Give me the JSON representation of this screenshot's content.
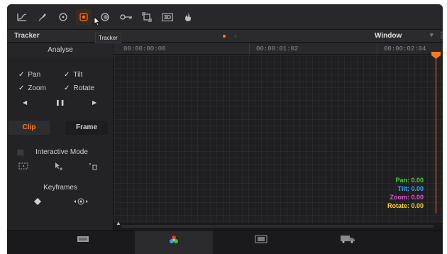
{
  "toolbar": {
    "icons": [
      "curves-icon",
      "qualifier-icon",
      "window-icon",
      "tracker-icon",
      "blur-icon",
      "key-icon",
      "sizing-icon",
      "3d-icon",
      "fire-icon"
    ],
    "three_d_label": "3D"
  },
  "tooltip": {
    "text": "Tracker"
  },
  "header": {
    "title": "Tracker",
    "mode": "Window",
    "mode_caret": "▾",
    "more": "⋮"
  },
  "left_panel": {
    "analyse_label": "Analyse",
    "checks": [
      {
        "label": "Pan",
        "checked": true
      },
      {
        "label": "Tilt",
        "checked": true
      },
      {
        "label": "Zoom",
        "checked": true
      },
      {
        "label": "Rotate",
        "checked": true
      }
    ],
    "check_mark": "✓",
    "playback": {
      "back": "◀",
      "pause": "❚❚",
      "forward": "▶"
    },
    "segments": {
      "clip": "Clip",
      "frame": "Frame",
      "selected": "Clip"
    },
    "interactive_mode_label": "Interactive Mode",
    "keyframes_label": "Keyframes"
  },
  "timeline": {
    "timecodes": [
      "00:00:00:00",
      "00:00:01:02",
      "00:00:02:04"
    ]
  },
  "readouts": [
    {
      "label": "Pan: 0.00",
      "color": "#3ad23a"
    },
    {
      "label": "Tilt: 0.00",
      "color": "#3aa8ff"
    },
    {
      "label": "Zoom: 0.00",
      "color": "#e050e0"
    },
    {
      "label": "Rotate: 0.00",
      "color": "#ffd23a"
    }
  ],
  "bottom_nav": {
    "items": [
      {
        "label": "",
        "icon": "media-icon",
        "active": false
      },
      {
        "label": "",
        "icon": "color-wheel-icon",
        "active": true
      },
      {
        "label": "",
        "icon": "gallery-icon",
        "active": false
      },
      {
        "label": "",
        "icon": "deliver-icon",
        "active": false
      }
    ]
  },
  "colors": {
    "accent": "#ff7a1a",
    "panel": "#232325",
    "background": "#1d1d1f"
  }
}
